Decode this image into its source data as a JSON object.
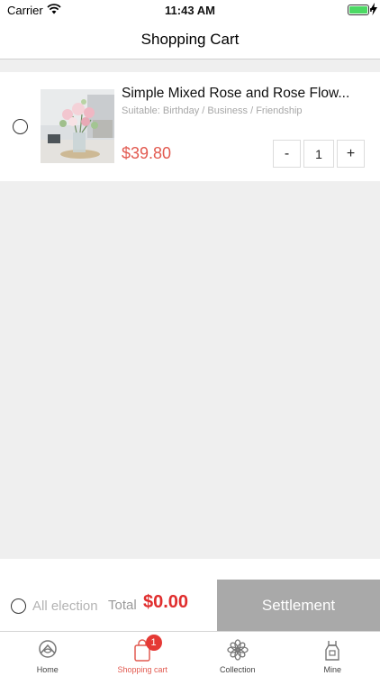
{
  "status_bar": {
    "carrier": "Carrier",
    "time": "11:43 AM",
    "battery_level": 1.0
  },
  "nav": {
    "title": "Shopping Cart"
  },
  "cart": {
    "items": [
      {
        "name": "Simple Mixed Rose and Rose Flow...",
        "suitable": "Suitable: Birthday / Business / Friendship",
        "price": "$39.80",
        "quantity": "1",
        "selected": false
      }
    ],
    "minus_label": "-",
    "plus_label": "+"
  },
  "checkout": {
    "all_label": "All election",
    "total_label": "Total",
    "total_value": "$0.00",
    "settle_label": "Settlement"
  },
  "tabs": [
    {
      "label": "Home",
      "icon": "home-icon"
    },
    {
      "label": "Shopping cart",
      "icon": "cart-icon",
      "badge": "1",
      "active": true
    },
    {
      "label": "Collection",
      "icon": "flower-icon"
    },
    {
      "label": "Mine",
      "icon": "apron-icon"
    }
  ],
  "colors": {
    "accent": "#e25a50",
    "total": "#e02e2e",
    "settle_bg": "#a9a9a9",
    "page_bg": "#efefef"
  }
}
